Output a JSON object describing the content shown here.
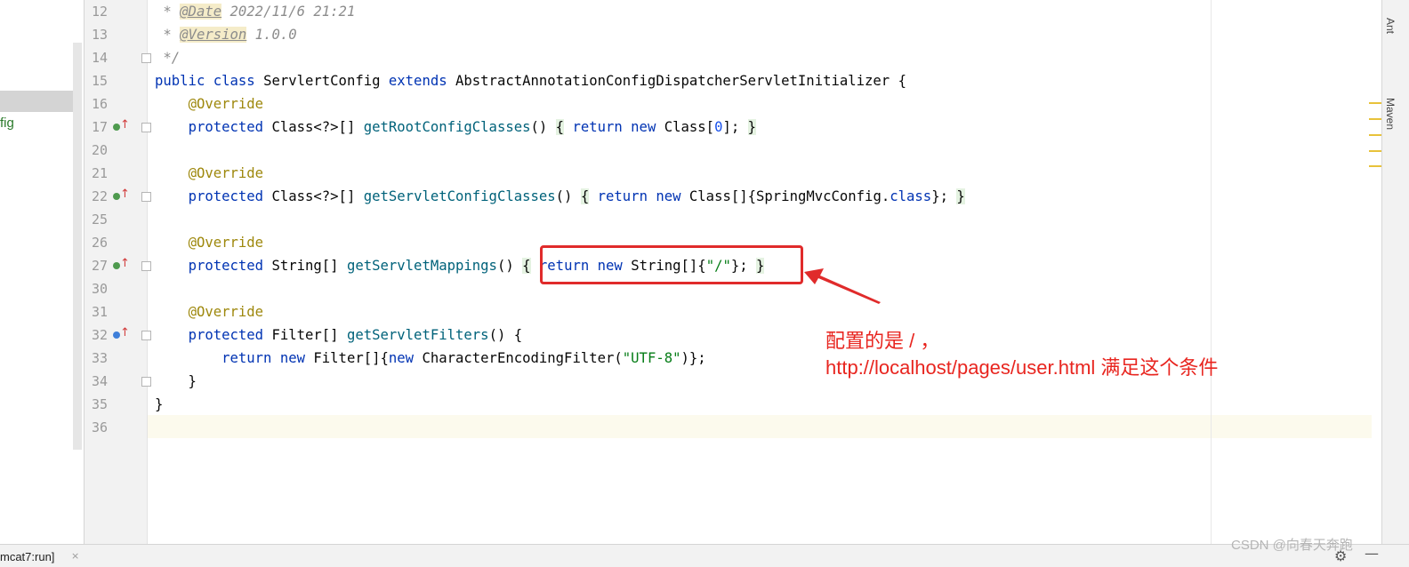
{
  "project": {
    "item_label": "fig"
  },
  "lines": [
    {
      "num": "12",
      "tokens": [
        {
          "t": " * ",
          "c": "cm"
        },
        {
          "t": "@Date",
          "c": "tag"
        },
        {
          "t": " 2022/11/6 21:21",
          "c": "cm"
        }
      ]
    },
    {
      "num": "13",
      "tokens": [
        {
          "t": " * ",
          "c": "cm"
        },
        {
          "t": "@Version",
          "c": "tag"
        },
        {
          "t": " 1.0.0",
          "c": "cm"
        }
      ]
    },
    {
      "num": "14",
      "tokens": [
        {
          "t": " */",
          "c": "cm"
        }
      ]
    },
    {
      "num": "15",
      "tokens": [
        {
          "t": "public class ",
          "c": "kw"
        },
        {
          "t": "ServlertConfig ",
          "c": ""
        },
        {
          "t": "extends ",
          "c": "kw"
        },
        {
          "t": "AbstractAnnotationConfigDispatcherServletInitializer {",
          "c": ""
        }
      ]
    },
    {
      "num": "16",
      "tokens": [
        {
          "t": "    ",
          "c": ""
        },
        {
          "t": "@Override",
          "c": "ann"
        }
      ]
    },
    {
      "num": "17",
      "tokens": [
        {
          "t": "    ",
          "c": ""
        },
        {
          "t": "protected ",
          "c": "kw"
        },
        {
          "t": "Class<?>[] ",
          "c": ""
        },
        {
          "t": "getRootConfigClasses",
          "c": "mth"
        },
        {
          "t": "() ",
          "c": ""
        },
        {
          "t": "{",
          "c": "brc"
        },
        {
          "t": " ",
          "c": ""
        },
        {
          "t": "return new ",
          "c": "kw"
        },
        {
          "t": "Class[",
          "c": ""
        },
        {
          "t": "0",
          "c": "num"
        },
        {
          "t": "]; ",
          "c": ""
        },
        {
          "t": "}",
          "c": "brc"
        }
      ]
    },
    {
      "num": "20",
      "tokens": []
    },
    {
      "num": "21",
      "tokens": [
        {
          "t": "    ",
          "c": ""
        },
        {
          "t": "@Override",
          "c": "ann"
        }
      ]
    },
    {
      "num": "22",
      "tokens": [
        {
          "t": "    ",
          "c": ""
        },
        {
          "t": "protected ",
          "c": "kw"
        },
        {
          "t": "Class<?>[] ",
          "c": ""
        },
        {
          "t": "getServletConfigClasses",
          "c": "mth"
        },
        {
          "t": "() ",
          "c": ""
        },
        {
          "t": "{",
          "c": "brc"
        },
        {
          "t": " ",
          "c": ""
        },
        {
          "t": "return new ",
          "c": "kw"
        },
        {
          "t": "Class[]{SpringMvcConfig.",
          "c": ""
        },
        {
          "t": "class",
          "c": "kw"
        },
        {
          "t": "}; ",
          "c": ""
        },
        {
          "t": "}",
          "c": "brc"
        }
      ]
    },
    {
      "num": "25",
      "tokens": []
    },
    {
      "num": "26",
      "tokens": [
        {
          "t": "    ",
          "c": ""
        },
        {
          "t": "@Override",
          "c": "ann"
        }
      ]
    },
    {
      "num": "27",
      "tokens": [
        {
          "t": "    ",
          "c": ""
        },
        {
          "t": "protected ",
          "c": "kw"
        },
        {
          "t": "String[] ",
          "c": ""
        },
        {
          "t": "getServletMappings",
          "c": "mth"
        },
        {
          "t": "() ",
          "c": ""
        },
        {
          "t": "{",
          "c": "brc"
        },
        {
          "t": " ",
          "c": ""
        },
        {
          "t": "return new ",
          "c": "kw"
        },
        {
          "t": "String[]{",
          "c": ""
        },
        {
          "t": "\"/\"",
          "c": "str"
        },
        {
          "t": "}; ",
          "c": ""
        },
        {
          "t": "}",
          "c": "brc"
        }
      ]
    },
    {
      "num": "30",
      "tokens": []
    },
    {
      "num": "31",
      "tokens": [
        {
          "t": "    ",
          "c": ""
        },
        {
          "t": "@Override",
          "c": "ann"
        }
      ]
    },
    {
      "num": "32",
      "tokens": [
        {
          "t": "    ",
          "c": ""
        },
        {
          "t": "protected ",
          "c": "kw"
        },
        {
          "t": "Filter[] ",
          "c": ""
        },
        {
          "t": "getServletFilters",
          "c": "mth"
        },
        {
          "t": "() {",
          "c": ""
        }
      ]
    },
    {
      "num": "33",
      "tokens": [
        {
          "t": "        ",
          "c": ""
        },
        {
          "t": "return new ",
          "c": "kw"
        },
        {
          "t": "Filter[]{",
          "c": ""
        },
        {
          "t": "new ",
          "c": "kw"
        },
        {
          "t": "CharacterEncodingFilter(",
          "c": ""
        },
        {
          "t": "\"UTF-8\"",
          "c": "str"
        },
        {
          "t": ")};",
          "c": ""
        }
      ]
    },
    {
      "num": "34",
      "tokens": [
        {
          "t": "    }",
          "c": ""
        }
      ]
    },
    {
      "num": "35",
      "tokens": [
        {
          "t": "}",
          "c": ""
        }
      ]
    },
    {
      "num": "36",
      "tokens": []
    }
  ],
  "annotation": {
    "line1": "配置的是 / ，",
    "line2": "http://localhost/pages/user.html 满足这个条件"
  },
  "side_tabs": {
    "ant": "Ant",
    "maven": "Maven"
  },
  "bottom": {
    "run_tab": "mcat7:run]",
    "close": "×",
    "watermark": "CSDN @向春天奔跑"
  },
  "colors": {
    "highlight_red": "#e02b2b",
    "annotation_red": "#e8251f",
    "keyword": "#0033b3",
    "annotation": "#9e880d",
    "string": "#067d17",
    "method": "#00627a"
  }
}
